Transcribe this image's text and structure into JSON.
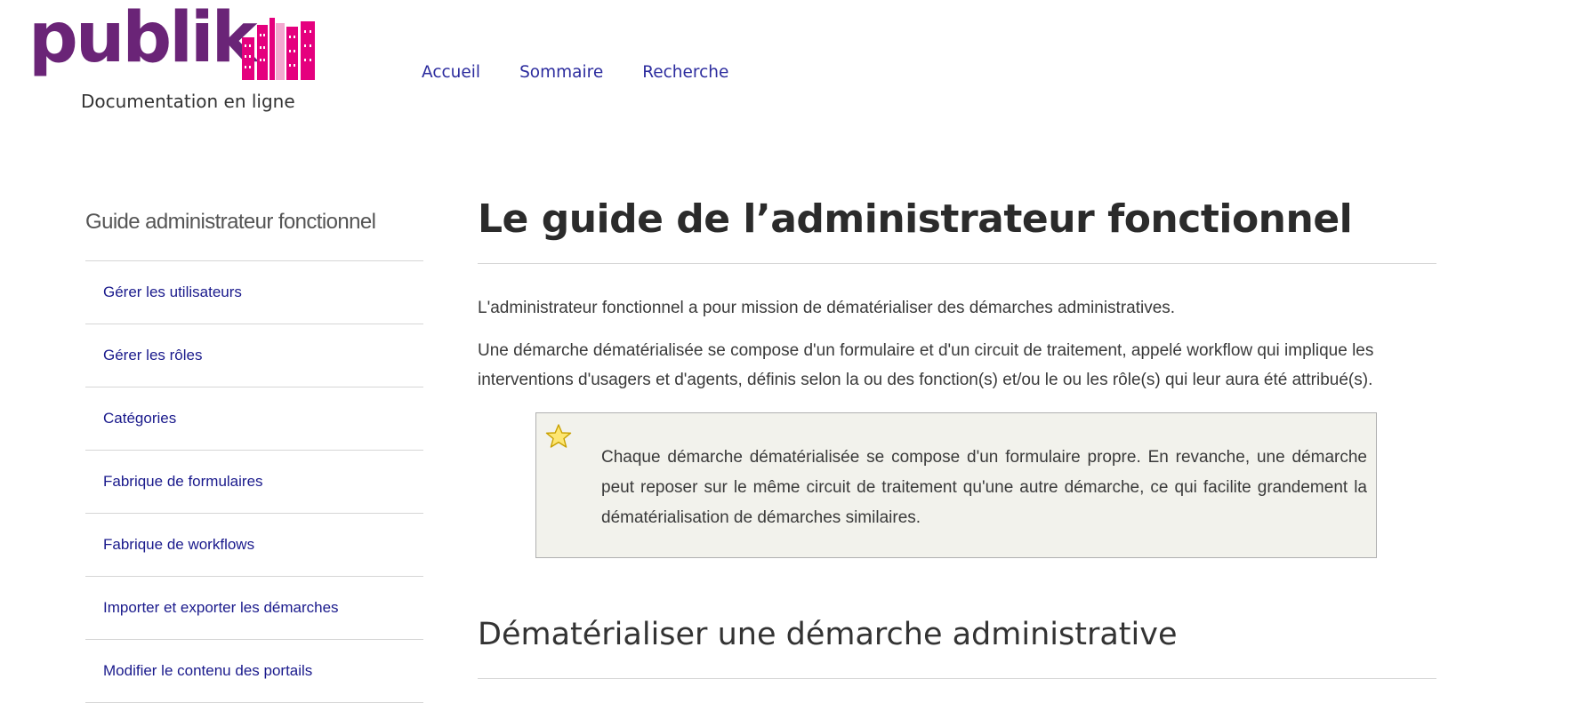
{
  "brand": {
    "name": "publik",
    "tagline": "Documentation en ligne",
    "colors": {
      "wordmark": "#6a2477",
      "bars": "#e5007e",
      "bars_light": "#f3a8cf"
    }
  },
  "topnav": {
    "items": [
      {
        "label": "Accueil"
      },
      {
        "label": "Sommaire"
      },
      {
        "label": "Recherche"
      }
    ]
  },
  "sidebar": {
    "title": "Guide administrateur fonctionnel",
    "items": [
      {
        "label": "Gérer les utilisateurs"
      },
      {
        "label": "Gérer les rôles"
      },
      {
        "label": "Catégories"
      },
      {
        "label": "Fabrique de formulaires"
      },
      {
        "label": "Fabrique de workflows"
      },
      {
        "label": "Importer et exporter les démarches"
      },
      {
        "label": "Modifier le contenu des portails"
      }
    ]
  },
  "main": {
    "title": "Le guide de l’administrateur fonctionnel",
    "paragraphs": [
      "L'administrateur fonctionnel a pour mission de dématérialiser des démarches administratives.",
      "Une démarche dématérialisée se compose d'un formulaire et d'un circuit de traitement, appelé workflow qui implique les interventions d'usagers et d'agents, définis selon la ou des fonction(s) et/ou le ou les rôle(s) qui leur aura été attribué(s)."
    ],
    "note": {
      "icon": "star-icon",
      "text": "Chaque démarche dématérialisée se compose d'un formulaire propre. En revanche, une démarche peut reposer sur le même circuit de traitement qu'une autre démarche, ce qui facilite grandement la dématérialisation de démarches similaires."
    },
    "section_title": "Dématérialiser une démarche administrative"
  }
}
